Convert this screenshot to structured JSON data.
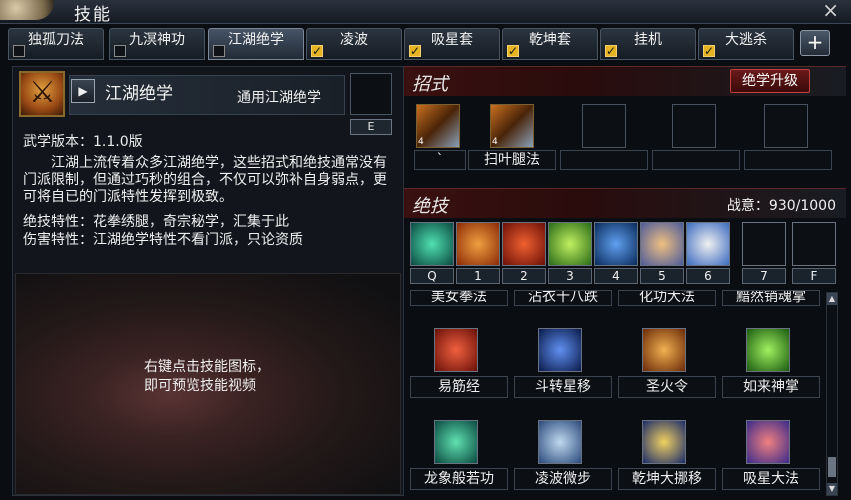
{
  "window": {
    "title": "技能",
    "close_label": "×"
  },
  "tabs": [
    {
      "label": "独孤刀法",
      "checked": false,
      "active": false
    },
    {
      "label": "九溟神功",
      "checked": false,
      "active": false
    },
    {
      "label": "江湖绝学",
      "checked": false,
      "active": true
    },
    {
      "label": "凌波",
      "checked": true,
      "active": false
    },
    {
      "label": "吸星套",
      "checked": true,
      "active": false
    },
    {
      "label": "乾坤套",
      "checked": true,
      "active": false
    },
    {
      "label": "挂机",
      "checked": true,
      "active": false
    },
    {
      "label": "大逃杀",
      "checked": true,
      "active": false
    }
  ],
  "add_tab_label": "+",
  "school": {
    "name": "江湖绝学",
    "type": "通用江湖绝学",
    "e_key": "E",
    "version": "武学版本：1.1.0版",
    "description": "江湖上流传着众多江湖绝学，这些招式和绝技通常没有门派限制，但通过巧秒的组合，不仅可以弥补自身弱点，更可将自已的门派特性发挥到极致。",
    "trait_unique": "绝技特性：花拳绣腿，奇宗秘学，汇集于此",
    "trait_damage": "伤害特性：江湖绝学特性不看门派，只论资质"
  },
  "preview_text": [
    "右键点击技能图标，",
    "即可预览技能视频"
  ],
  "moves": {
    "heading": "招式",
    "upgrade_label": "绝学升级",
    "slots": [
      {
        "name": "`",
        "level": "4",
        "filled": true
      },
      {
        "name": "扫叶腿法",
        "level": "4",
        "filled": true
      },
      {
        "name": "",
        "filled": false
      },
      {
        "name": "",
        "filled": false
      },
      {
        "name": "",
        "filled": false
      }
    ]
  },
  "unique": {
    "heading": "绝技",
    "zhanyi": "战意：930/1000",
    "hotkeys": [
      "Q",
      "1",
      "2",
      "3",
      "4",
      "5",
      "6",
      "7",
      "F"
    ],
    "partial_labels": [
      "美女拳法",
      "沾衣十八跌",
      "化功大法",
      "黯然销魂掌"
    ],
    "skills_row1": [
      "易筋经",
      "斗转星移",
      "圣火令",
      "如来神掌"
    ],
    "skills_row2": [
      "龙象般若功",
      "凌波微步",
      "乾坤大挪移",
      "吸星大法"
    ]
  },
  "colors": {
    "accent": "#e6b422",
    "danger": "#c04040",
    "panel": "#12161c"
  }
}
